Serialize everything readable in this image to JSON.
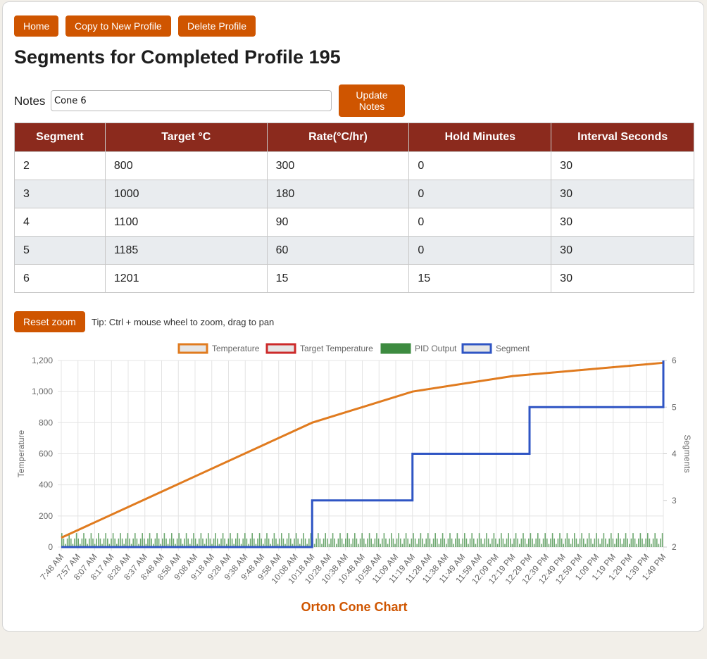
{
  "toolbar": {
    "home_label": "Home",
    "copy_label": "Copy to New Profile",
    "delete_label": "Delete Profile"
  },
  "page": {
    "title": "Segments for Completed Profile 195"
  },
  "notes": {
    "label": "Notes",
    "value": "Cone 6",
    "update_label_line1": "Update",
    "update_label_line2": "Notes"
  },
  "table": {
    "headers": [
      "Segment",
      "Target °C",
      "Rate(°C/hr)",
      "Hold Minutes",
      "Interval Seconds"
    ],
    "rows": [
      [
        "2",
        "800",
        "300",
        "0",
        "30"
      ],
      [
        "3",
        "1000",
        "180",
        "0",
        "30"
      ],
      [
        "4",
        "1100",
        "90",
        "0",
        "30"
      ],
      [
        "5",
        "1185",
        "60",
        "0",
        "30"
      ],
      [
        "6",
        "1201",
        "15",
        "15",
        "30"
      ]
    ]
  },
  "chart_controls": {
    "reset_zoom_label": "Reset zoom",
    "tip": "Tip: Ctrl + mouse wheel to zoom, drag to pan"
  },
  "colors": {
    "button": "#cf5500",
    "header": "#8b2a1d",
    "temperature": "#e07b1f",
    "target": "#cc2a2a",
    "pid": "#3d8b40",
    "segment": "#2f55c4",
    "chart_title": "#cf5500"
  },
  "chart_data": {
    "type": "line",
    "title": "Orton Cone Chart",
    "ylabel": "Temperature",
    "y2label": "Segments",
    "ylim": [
      0,
      1200
    ],
    "y2lim": [
      2,
      6
    ],
    "yticks": [
      "0",
      "200",
      "400",
      "600",
      "800",
      "1,000",
      "1,200"
    ],
    "y2ticks": [
      "2",
      "3",
      "4",
      "5",
      "6"
    ],
    "legend_position": "top",
    "grid": true,
    "xticks": [
      "7:48 AM",
      "7:57 AM",
      "8:07 AM",
      "8:17 AM",
      "8:28 AM",
      "8:37 AM",
      "8:48 AM",
      "8:58 AM",
      "9:08 AM",
      "9:18 AM",
      "9:28 AM",
      "9:38 AM",
      "9:48 AM",
      "9:58 AM",
      "10:08 AM",
      "10:18 AM",
      "10:28 AM",
      "10:38 AM",
      "10:48 AM",
      "10:58 AM",
      "11:09 AM",
      "11:19 AM",
      "11:28 AM",
      "11:38 AM",
      "11:49 AM",
      "11:59 AM",
      "12:09 PM",
      "12:19 PM",
      "12:29 PM",
      "12:39 PM",
      "12:49 PM",
      "12:59 PM",
      "1:09 PM",
      "1:19 PM",
      "1:29 PM",
      "1:39 PM",
      "1:49 PM"
    ],
    "series": [
      {
        "name": "Temperature",
        "axis": "left",
        "x": [
          "7:48 AM",
          "10:18 AM",
          "11:19 AM",
          "12:19 PM",
          "1:49 PM"
        ],
        "values": [
          60,
          800,
          1000,
          1100,
          1185
        ]
      },
      {
        "name": "Target Temperature",
        "axis": "left",
        "x": [
          "7:48 AM",
          "10:18 AM",
          "11:19 AM",
          "12:19 PM",
          "1:49 PM"
        ],
        "values": [
          62,
          802,
          1002,
          1102,
          1187
        ]
      },
      {
        "name": "PID Output",
        "axis": "left",
        "type": "bar",
        "typical_values": [
          20,
          90
        ],
        "from": "7:48 AM",
        "to": "1:49 PM"
      },
      {
        "name": "Segment",
        "axis": "right",
        "x": [
          "7:48 AM",
          "10:18 AM",
          "11:19 AM",
          "12:29 PM",
          "1:49 PM"
        ],
        "values": [
          2,
          3,
          4,
          5,
          6
        ]
      }
    ]
  }
}
